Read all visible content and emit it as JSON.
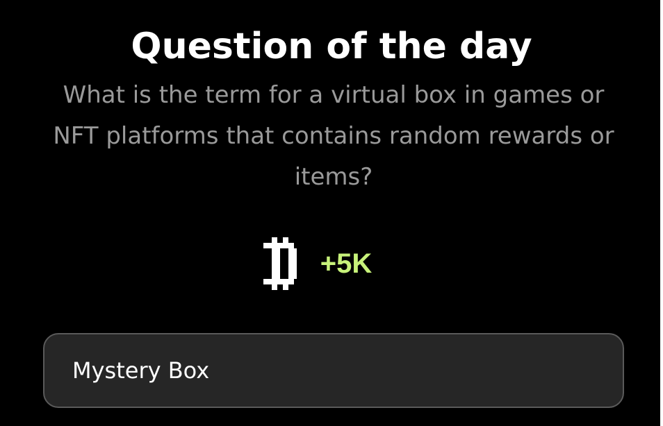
{
  "title": "Question of the day",
  "question": "What is the term for a virtual box in games or NFT platforms that contains random rewards or items?",
  "reward": {
    "icon": "pixel-coin-icon",
    "amount": "+5K",
    "color": "#c7f27a"
  },
  "answer": {
    "label": "Mystery Box"
  }
}
